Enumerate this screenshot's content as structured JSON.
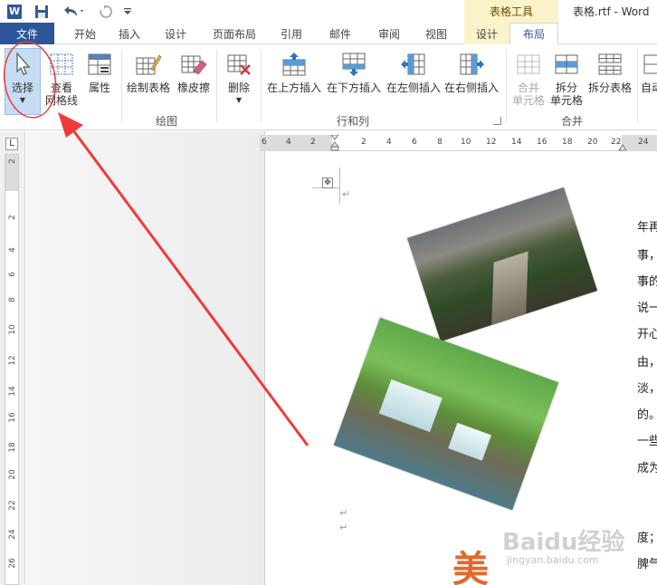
{
  "title_bar": {
    "app_icon": "word-icon",
    "app_icon_letter": "W",
    "context_group": "表格工具",
    "doc_title": "表格.rtf - Word"
  },
  "tabs": [
    {
      "label": "文件"
    },
    {
      "label": "开始"
    },
    {
      "label": "插入"
    },
    {
      "label": "设计"
    },
    {
      "label": "页面布局"
    },
    {
      "label": "引用"
    },
    {
      "label": "邮件"
    },
    {
      "label": "审阅"
    },
    {
      "label": "视图"
    },
    {
      "label": "设计"
    },
    {
      "label": "布局"
    }
  ],
  "ribbon": {
    "select": "选择",
    "view_gridlines_1": "查看",
    "view_gridlines_2": "网格线",
    "properties": "属性",
    "draw_table": "绘制表格",
    "eraser": "橡皮擦",
    "group_draw": "绘图",
    "delete": "删除",
    "insert_above": "在上方插入",
    "insert_below": "在下方插入",
    "insert_left": "在左侧插入",
    "insert_right": "在右侧插入",
    "group_rows_cols": "行和列",
    "merge_cells_1": "合并",
    "merge_cells_2": "单元格",
    "split_cells_1": "拆分",
    "split_cells_2": "单元格",
    "split_table": "拆分表格",
    "group_merge": "合并",
    "autofit": "自动"
  },
  "ruler": {
    "tab_selector": "L",
    "h_ticks": [
      "6",
      "4",
      "2",
      "2",
      "4",
      "6",
      "8",
      "10",
      "12",
      "14",
      "16",
      "18",
      "20",
      "22",
      "24"
    ],
    "v_ticks": [
      "2",
      "2",
      "4",
      "6",
      "8",
      "10",
      "12",
      "14",
      "16",
      "18",
      "20",
      "22",
      "24",
      "26"
    ]
  },
  "document": {
    "body_chars": [
      "年再",
      "事，",
      "事的",
      "说一",
      "开心",
      "由，",
      "淡，",
      "的。",
      "一些",
      "成为",
      "度；",
      "脾气"
    ],
    "watermark": "Baidu经验",
    "watermark_sub": "jingyan.baidu.com",
    "stamp_char": "美"
  },
  "colors": {
    "file_tab": "#2b579a",
    "context_tab": "#fbf3c9",
    "selected_button": "#c5dcf2",
    "annotation_red": "#ee3b3b"
  }
}
